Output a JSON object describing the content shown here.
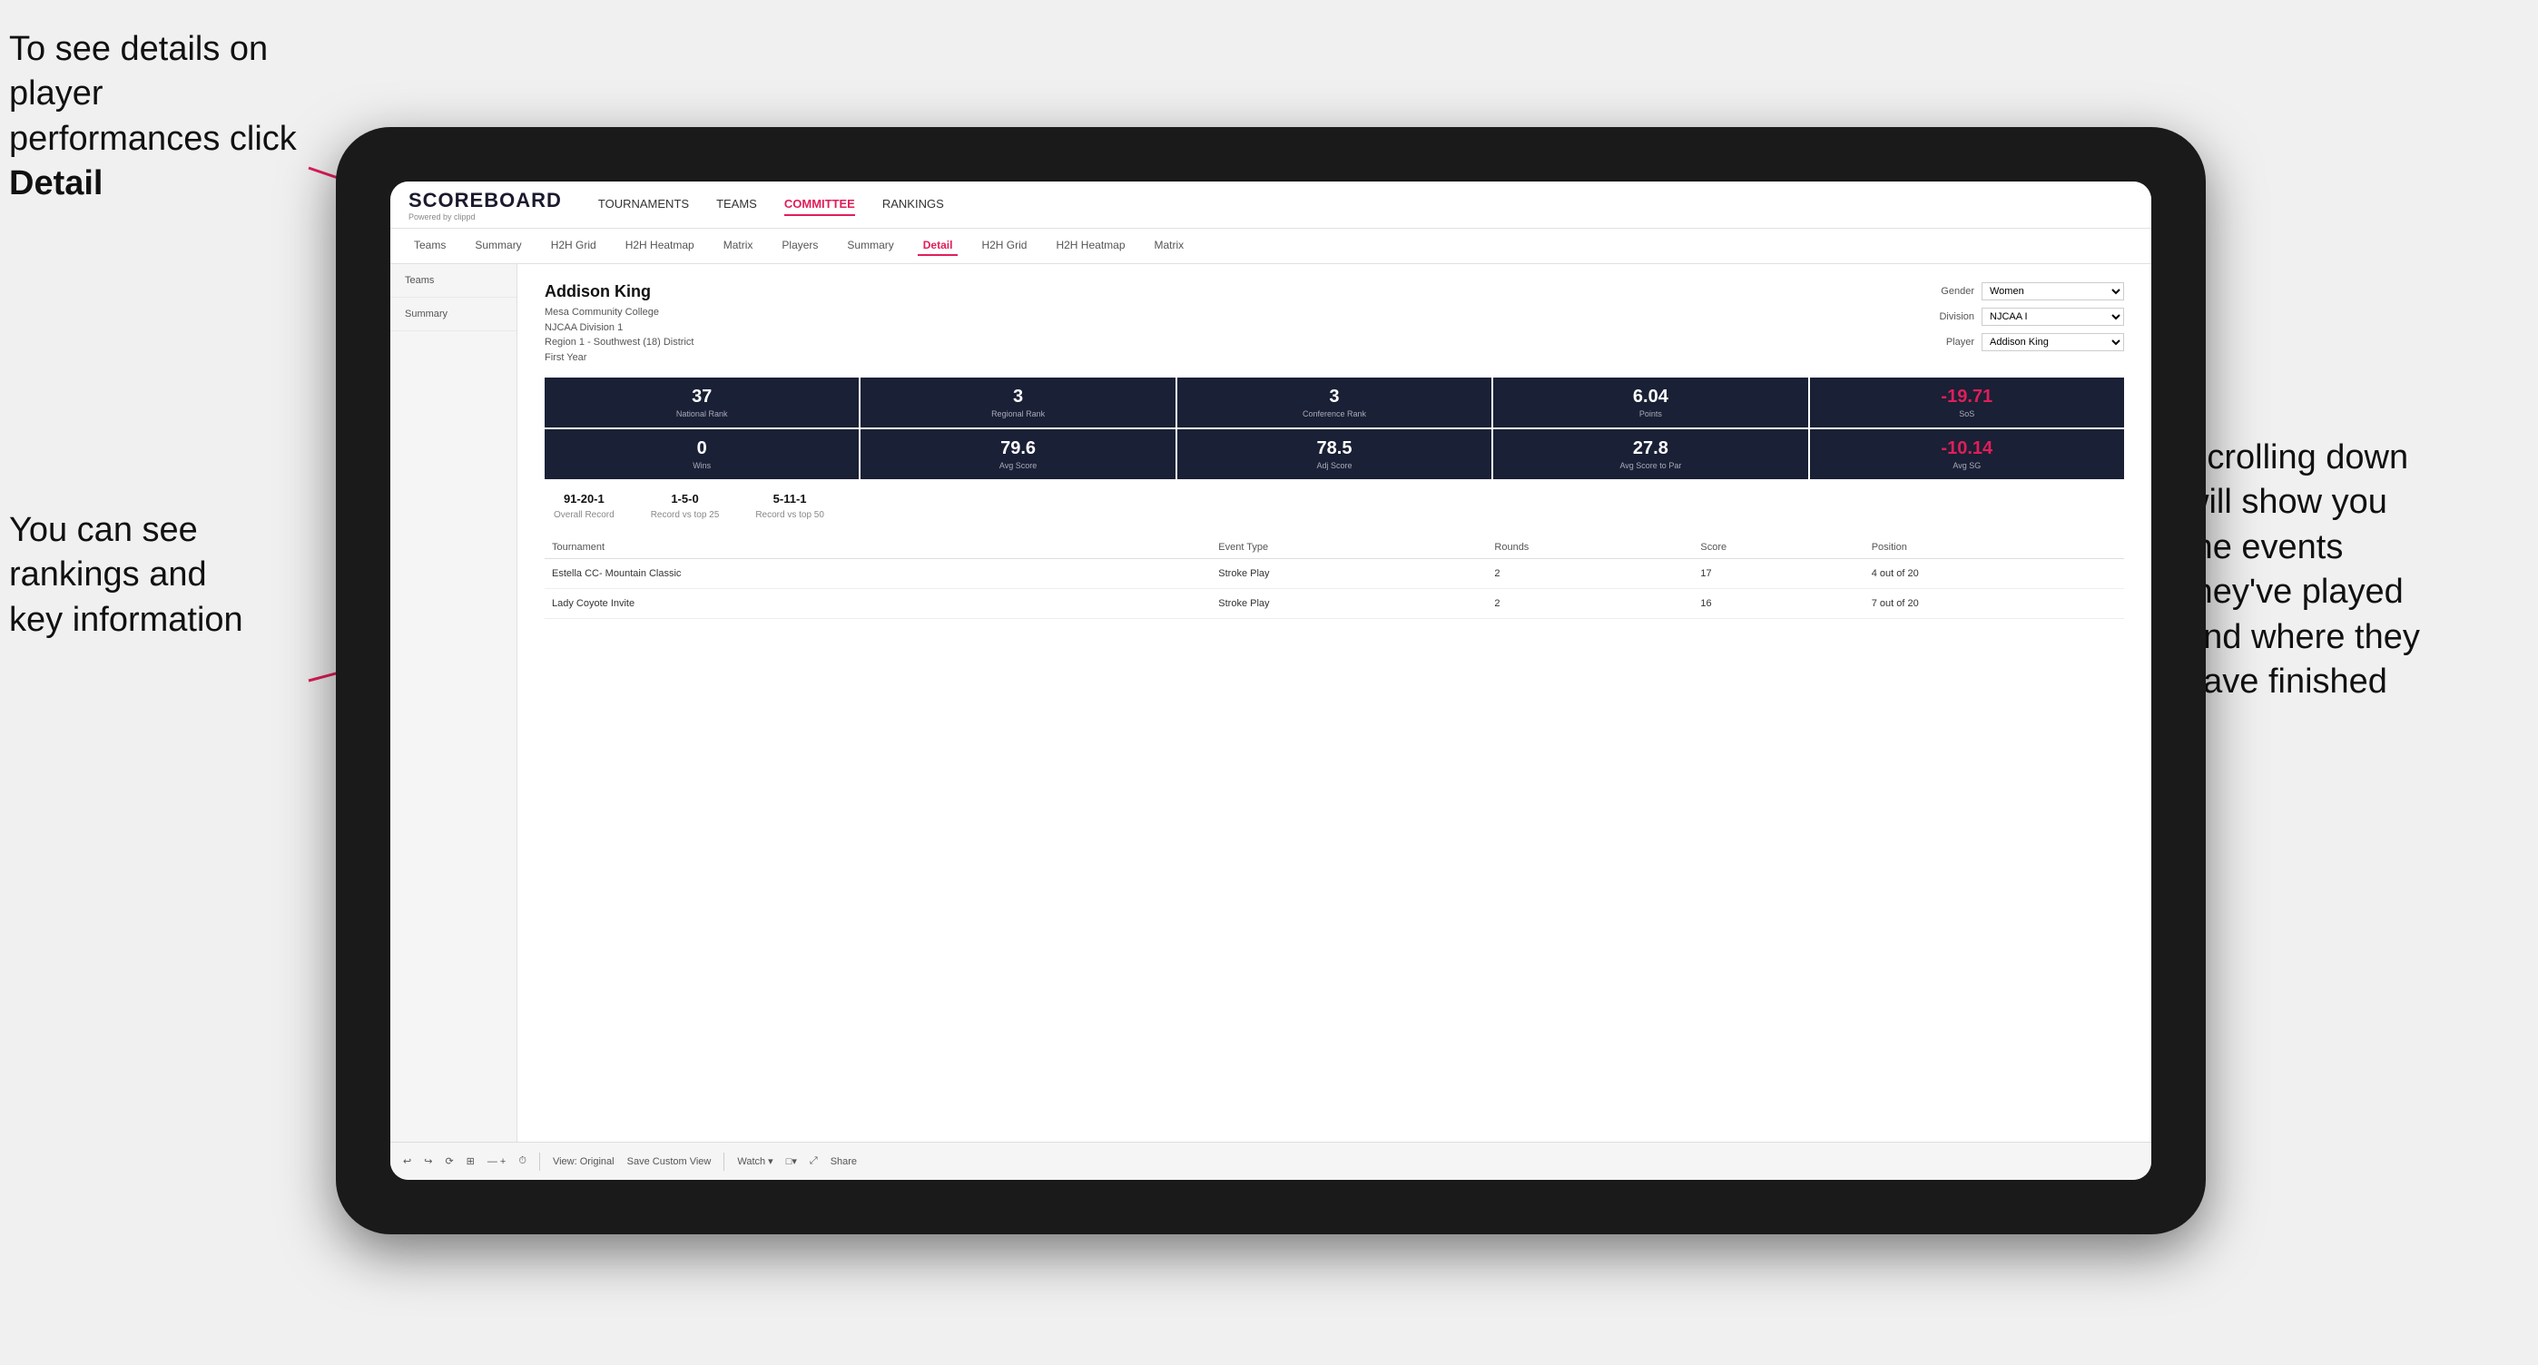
{
  "annotations": {
    "top_left": "To see details on player performances click ",
    "top_left_bold": "Detail",
    "bottom_left_line1": "You can see",
    "bottom_left_line2": "rankings and",
    "bottom_left_line3": "key information",
    "right_line1": "Scrolling down",
    "right_line2": "will show you",
    "right_line3": "the events",
    "right_line4": "they've played",
    "right_line5": "and where they",
    "right_line6": "have finished"
  },
  "header": {
    "logo": "SCOREBOARD",
    "logo_sub": "Powered by clippd",
    "nav": [
      "TOURNAMENTS",
      "TEAMS",
      "COMMITTEE",
      "RANKINGS"
    ],
    "active_nav": "COMMITTEE"
  },
  "sub_nav": {
    "items": [
      "Teams",
      "Summary",
      "H2H Grid",
      "H2H Heatmap",
      "Matrix",
      "Players",
      "Summary",
      "Detail",
      "H2H Grid",
      "H2H Heatmap",
      "Matrix"
    ],
    "active": "Detail"
  },
  "player": {
    "name": "Addison King",
    "college": "Mesa Community College",
    "division": "NJCAA Division 1",
    "region": "Region 1 - Southwest (18) District",
    "year": "First Year"
  },
  "filters": {
    "gender_label": "Gender",
    "gender_value": "Women",
    "division_label": "Division",
    "division_value": "NJCAA I",
    "player_label": "Player",
    "player_value": "Addison King"
  },
  "stats_row1": [
    {
      "value": "37",
      "label": "National Rank",
      "negative": false
    },
    {
      "value": "3",
      "label": "Regional Rank",
      "negative": false
    },
    {
      "value": "3",
      "label": "Conference Rank",
      "negative": false
    },
    {
      "value": "6.04",
      "label": "Points",
      "negative": false
    },
    {
      "value": "-19.71",
      "label": "SoS",
      "negative": true
    }
  ],
  "stats_row2": [
    {
      "value": "0",
      "label": "Wins",
      "negative": false
    },
    {
      "value": "79.6",
      "label": "Avg Score",
      "negative": false
    },
    {
      "value": "78.5",
      "label": "Adj Score",
      "negative": false
    },
    {
      "value": "27.8",
      "label": "Avg Score to Par",
      "negative": false
    },
    {
      "value": "-10.14",
      "label": "Avg SG",
      "negative": true
    }
  ],
  "records": [
    {
      "value": "91-20-1",
      "label": "Overall Record"
    },
    {
      "value": "1-5-0",
      "label": "Record vs top 25"
    },
    {
      "value": "5-11-1",
      "label": "Record vs top 50"
    }
  ],
  "table": {
    "headers": [
      "Tournament",
      "",
      "Event Type",
      "Rounds",
      "Score",
      "Position"
    ],
    "rows": [
      {
        "tournament": "Estella CC- Mountain Classic",
        "event_type": "Stroke Play",
        "rounds": "2",
        "score": "17",
        "position": "4 out of 20"
      },
      {
        "tournament": "Lady Coyote Invite",
        "event_type": "Stroke Play",
        "rounds": "2",
        "score": "16",
        "position": "7 out of 20"
      }
    ]
  },
  "toolbar": {
    "buttons": [
      "↩",
      "↪",
      "⟳",
      "⊞",
      "— +",
      "⏱",
      "View: Original",
      "Save Custom View",
      "Watch ▾",
      "□▾",
      "⤢",
      "Share"
    ]
  }
}
